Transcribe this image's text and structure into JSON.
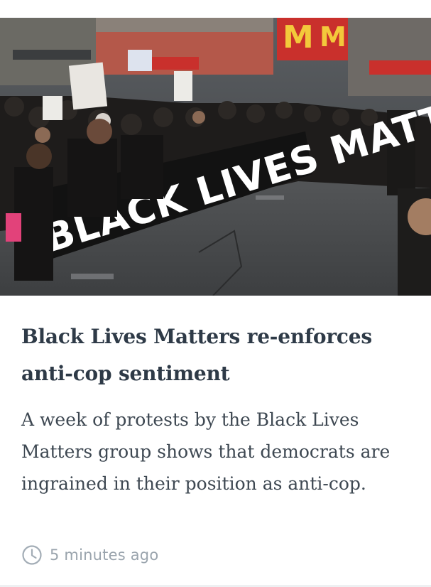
{
  "article": {
    "image_alt": "Protesters marching behind a BLACK LIVES MATTER banner",
    "image_banner_text": "BLACK LIVES MATTER",
    "title": "Black Lives Matters re-enforces anti-cop sentiment",
    "summary": "A week of protests by the Black Lives Matters group shows that democrats are ingrained in their position as anti-cop.",
    "timestamp": "5 minutes ago",
    "timestamp_icon": "clock-icon"
  }
}
